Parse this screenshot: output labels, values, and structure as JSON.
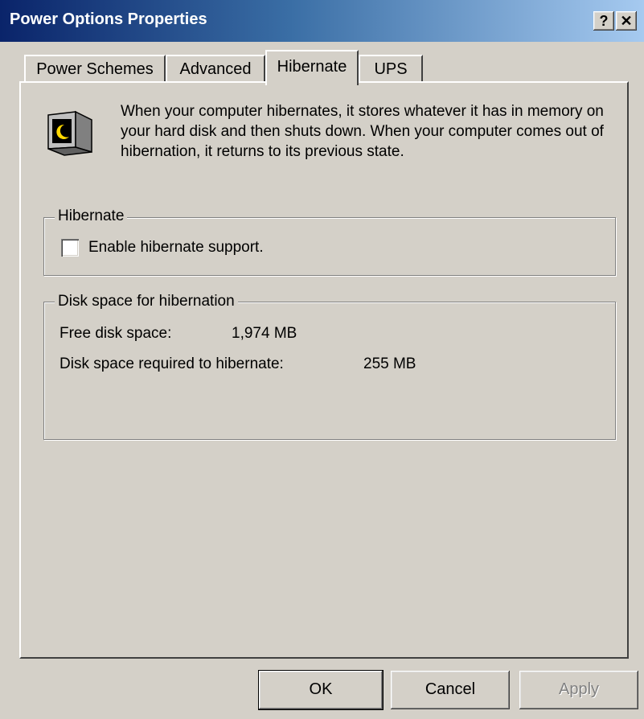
{
  "window": {
    "title": "Power Options Properties",
    "help_button": "?",
    "close_button": "✕"
  },
  "tabs": [
    {
      "label": "Power Schemes",
      "active": false
    },
    {
      "label": "Advanced",
      "active": false
    },
    {
      "label": "Hibernate",
      "active": true
    },
    {
      "label": "UPS",
      "active": false
    }
  ],
  "hibernate_page": {
    "icon": "hibernate-monitor-moon-icon",
    "description": "When your computer hibernates, it stores whatever it has in memory on your hard disk and then shuts down. When your computer comes out of hibernation, it returns to its previous state.",
    "hibernate_group": {
      "legend": "Hibernate",
      "checkbox_label": "Enable hibernate support.",
      "checked": false
    },
    "disk_group": {
      "legend": "Disk space for hibernation",
      "free_label": "Free disk space:",
      "free_value": "1,974 MB",
      "required_label": "Disk space required to hibernate:",
      "required_value": "255 MB"
    }
  },
  "buttons": {
    "ok": "OK",
    "cancel": "Cancel",
    "apply": "Apply"
  }
}
